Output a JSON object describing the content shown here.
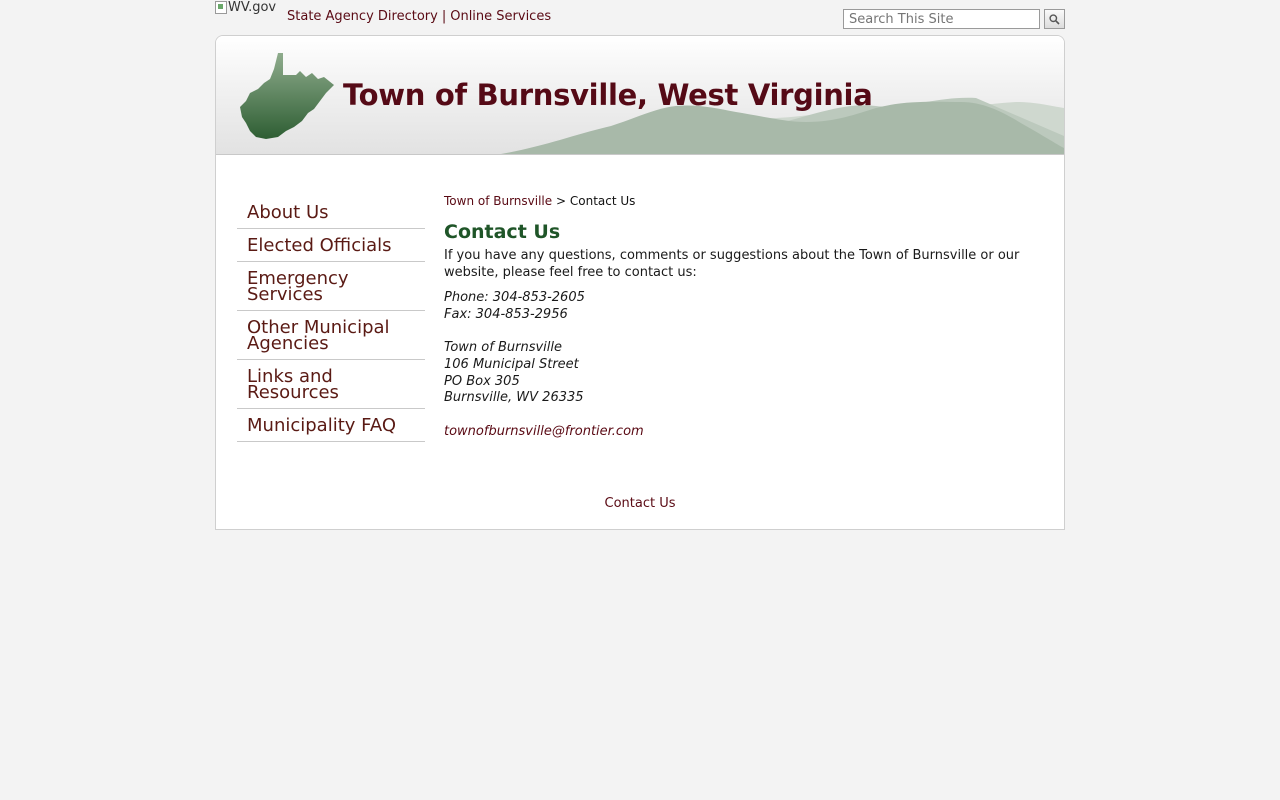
{
  "top": {
    "logo_alt": "WV.gov",
    "links": [
      {
        "label": "State Agency Directory"
      },
      {
        "label": "Online Services"
      }
    ],
    "separator": "|",
    "search_placeholder": "Search This Site"
  },
  "header": {
    "title": "Town of Burnsville, West Virginia"
  },
  "sidebar": {
    "items": [
      {
        "label": "About Us"
      },
      {
        "label": "Elected Officials"
      },
      {
        "label_line1": "Emergency",
        "label_line2": "Services"
      },
      {
        "label_line1": "Other Municipal",
        "label_line2": "Agencies"
      },
      {
        "label_line1": "Links and",
        "label_line2": "Resources"
      },
      {
        "label": "Municipality FAQ"
      }
    ]
  },
  "breadcrumb": {
    "home": "Town of Burnsville",
    "separator": ">",
    "current": "Contact Us"
  },
  "main": {
    "title": "Contact Us",
    "intro": "If you have any questions, comments or suggestions about the Town of Burnsville or our website, please feel free to contact us:",
    "phone": "Phone: 304-853-2605",
    "fax": "Fax: 304-853-2956",
    "address": {
      "name": "Town of Burnsville",
      "street": "106 Municipal Street",
      "po_box": "PO Box 305",
      "city_state_zip": "Burnsville, WV 26335"
    },
    "email": "townofburnsville@frontier.com"
  },
  "footer": {
    "link": "Contact Us"
  },
  "colors": {
    "link": "#5a0a14",
    "title": "#1f5528",
    "banner_title": "#550a16",
    "state_green": "#3d6e42"
  },
  "icons": {
    "search": "magnifier-icon",
    "state": "west-virginia-state-icon"
  }
}
